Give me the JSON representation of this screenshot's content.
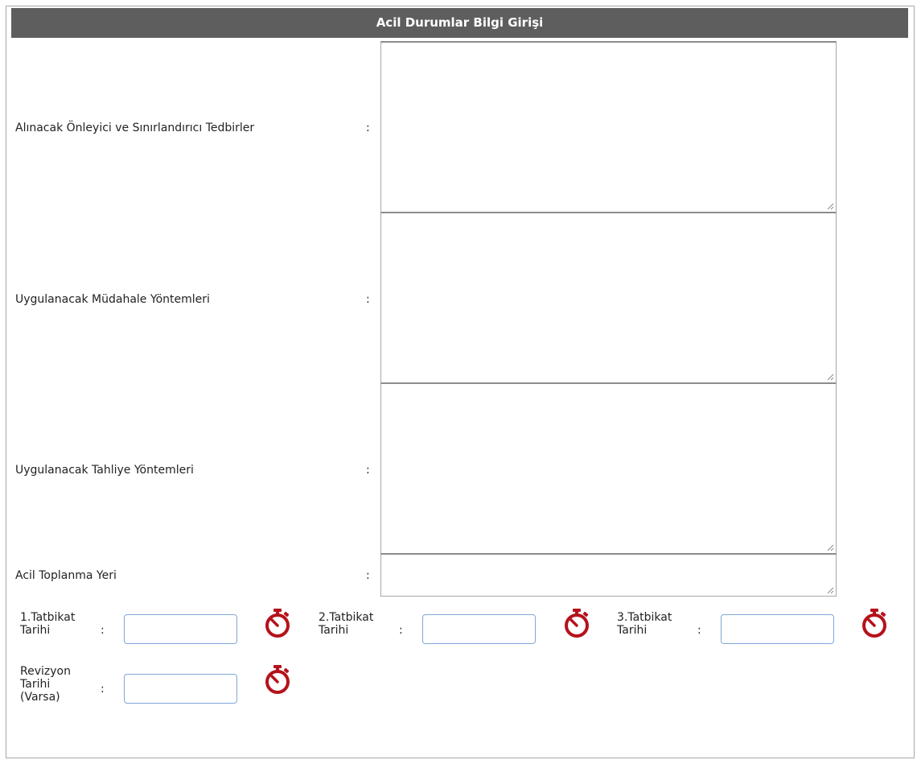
{
  "panel": {
    "title": "Acil Durumlar Bilgi Girişi"
  },
  "fields": {
    "preventive_measures": {
      "label": "Alınacak Önleyici ve Sınırlandırıcı Tedbirler",
      "colon": ":",
      "value": ""
    },
    "intervention_methods": {
      "label": "Uygulanacak Müdahale Yöntemleri",
      "colon": ":",
      "value": ""
    },
    "evacuation_methods": {
      "label": "Uygulanacak Tahliye Yöntemleri",
      "colon": ":",
      "value": ""
    },
    "assembly_point": {
      "label": "Acil Toplanma Yeri",
      "colon": ":",
      "value": ""
    }
  },
  "dates": {
    "drill1": {
      "label_line1": "1.Tatbikat",
      "label_line2": "Tarihi",
      "colon": ":",
      "value": "",
      "icon": "stopwatch-icon"
    },
    "drill2": {
      "label_line1": "2.Tatbikat",
      "label_line2": "Tarihi",
      "colon": ":",
      "value": "",
      "icon": "stopwatch-icon"
    },
    "drill3": {
      "label_line1": "3.Tatbikat",
      "label_line2": "Tarihi",
      "colon": ":",
      "value": "",
      "icon": "stopwatch-icon"
    },
    "revision": {
      "label_line1": "Revizyon",
      "label_line2": "Tarihi",
      "label_line3": "(Varsa)",
      "colon": ":",
      "value": "",
      "icon": "stopwatch-icon"
    }
  },
  "colors": {
    "header_bg": "#5e5e5e",
    "icon": "#b5121b",
    "input_border": "#7fa7d6"
  }
}
